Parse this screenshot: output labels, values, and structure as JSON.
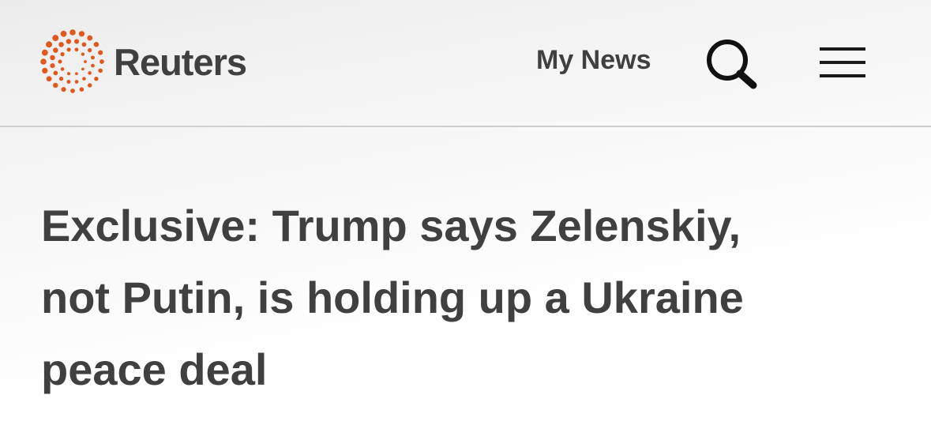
{
  "header": {
    "brand": "Reuters",
    "logo_icon": "reuters-dots-logo-icon",
    "my_news_label": "My News",
    "search_icon": "search-icon",
    "menu_icon": "hamburger-menu-icon",
    "accent_color": "#e0581c",
    "text_color": "#404040"
  },
  "article": {
    "headline_lines": [
      "Exclusive: Trump says Zelenskiy,",
      "not Putin, is holding up a Ukraine",
      "peace deal"
    ]
  }
}
